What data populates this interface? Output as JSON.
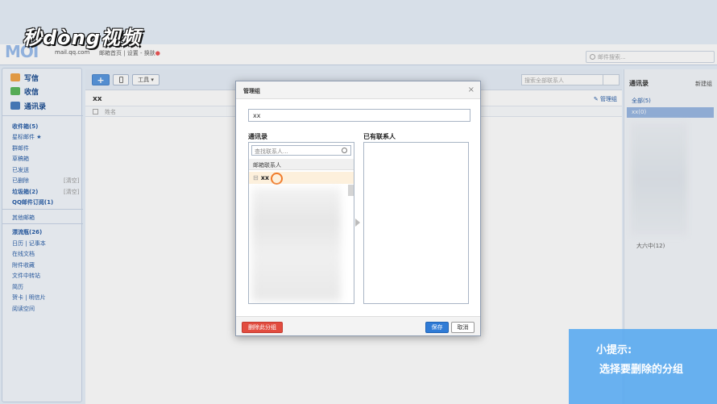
{
  "watermark": "秒dòng视频",
  "header": {
    "logo": "MOI",
    "domain": "mail.qq.com",
    "links": "邮箱首页 | 设置 - 换肤",
    "search_placeholder": "邮件搜索..."
  },
  "sidebar": {
    "actions": [
      {
        "label": "写信",
        "icon": "compose-icon",
        "color": "#f2a54a"
      },
      {
        "label": "收信",
        "icon": "inbox-icon",
        "color": "#5cb85c"
      },
      {
        "label": "通讯录",
        "icon": "contacts-icon",
        "color": "#4a7fc1"
      }
    ],
    "folders": [
      {
        "label": "收件箱(5)",
        "bold": true
      },
      {
        "label": "星标邮件 ★",
        "bold": false
      },
      {
        "label": "群邮件",
        "bold": false
      },
      {
        "label": "草稿箱",
        "bold": false
      },
      {
        "label": "已发送",
        "bold": false
      },
      {
        "label": "已删除",
        "bold": false,
        "extra": "[清空]"
      },
      {
        "label": "垃圾箱(2)",
        "bold": true,
        "extra": "[清空]"
      },
      {
        "label": "QQ邮件订阅(1)",
        "bold": true
      },
      {
        "label": "其他邮箱",
        "bold": false
      },
      {
        "label": "漂流瓶(26)",
        "bold": true
      },
      {
        "label": "日历 | 记事本",
        "bold": false
      },
      {
        "label": "在线文档",
        "bold": false
      },
      {
        "label": "附件收藏",
        "bold": false
      },
      {
        "label": "文件中转站",
        "bold": false
      },
      {
        "label": "简历",
        "bold": false
      },
      {
        "label": "贺卡 | 明信片",
        "bold": false
      },
      {
        "label": "阅读空间",
        "bold": false
      }
    ]
  },
  "main": {
    "add_label": "+",
    "tools_label": "工具 ▾",
    "search_placeholder": "搜索全部联系人",
    "group_title": "xx",
    "manage_group": "管理组",
    "col_name": "姓名"
  },
  "right_panel": {
    "title": "通讯录",
    "new_group": "新建组",
    "all": "全部(5)",
    "selected": "xx(0)",
    "item": "大六中(12)"
  },
  "dialog": {
    "title": "管理组",
    "close": "×",
    "group_name": "xx",
    "left_label": "通讯录",
    "right_label": "已有联系人",
    "find_placeholder": "查找联系人...",
    "mailbox_contacts": "邮箱联系人",
    "selected_group": "xx",
    "delete_label": "删除此分组",
    "save_label": "保存",
    "cancel_label": "取消"
  },
  "tip": {
    "title": "小提示:",
    "text": "选择要删除的分组"
  }
}
